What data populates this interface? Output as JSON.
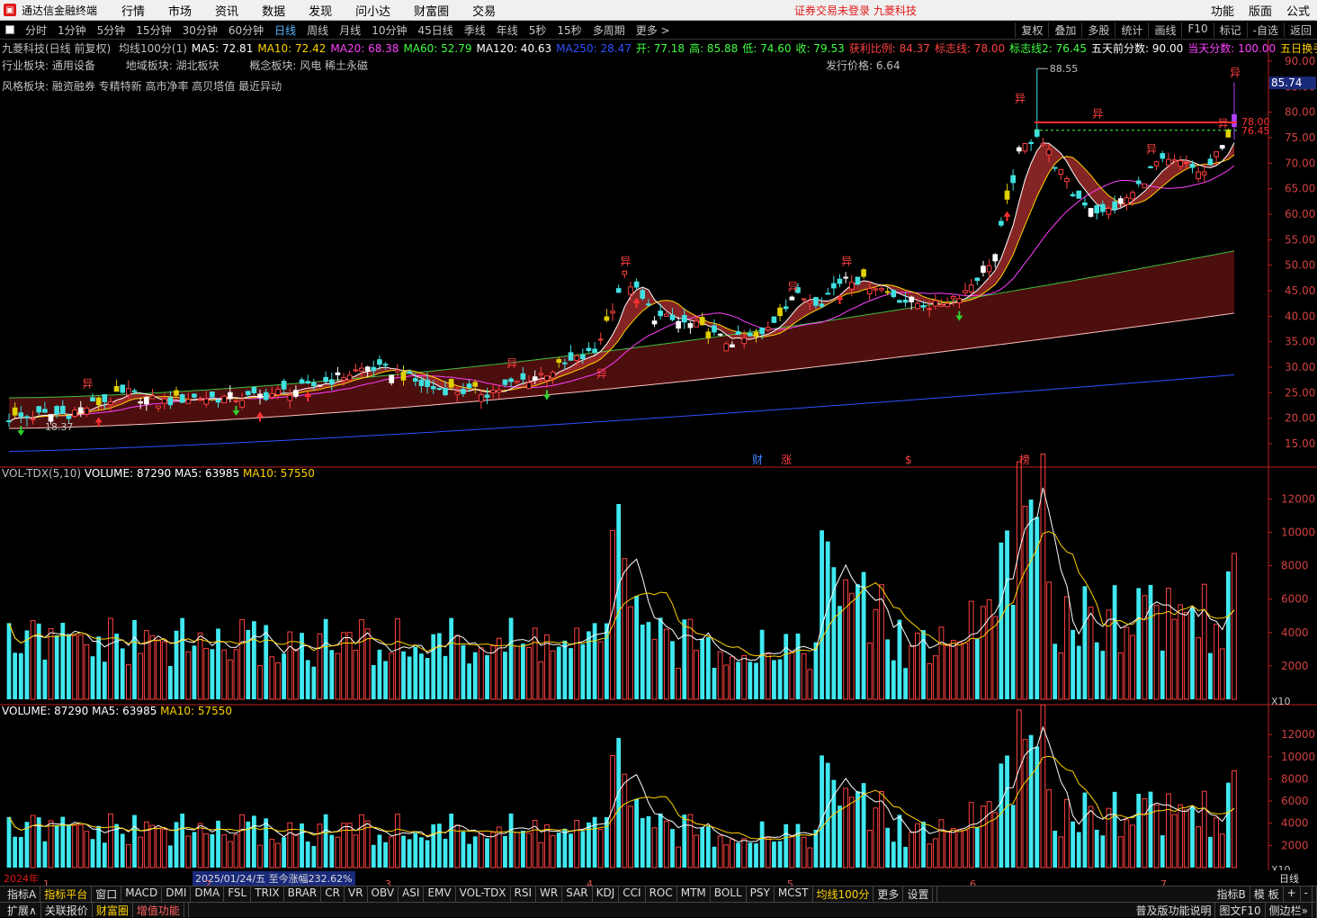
{
  "app": {
    "title": "通达信金融终端",
    "menu": [
      "行情",
      "市场",
      "资讯",
      "数据",
      "发现",
      "问小达",
      "财富圈",
      "交易"
    ],
    "notice": "证券交易未登录",
    "stock_name": "九菱科技",
    "right_menu": [
      "功能",
      "版面",
      "公式"
    ]
  },
  "periods": [
    "分时",
    "1分钟",
    "5分钟",
    "15分钟",
    "30分钟",
    "60分钟",
    "日线",
    "周线",
    "月线",
    "10分钟",
    "45日线",
    "季线",
    "年线",
    "5秒",
    "15秒",
    "多周期",
    "更多 >"
  ],
  "active_period": "日线",
  "toolbar_right": [
    "复权",
    "叠加",
    "多股",
    "统计",
    "画线",
    "F10",
    "标记",
    "-自选",
    "返回"
  ],
  "header": {
    "title": "九菱科技(日线 前复权)",
    "items": [
      {
        "t": "均线100分(1)",
        "c": "#c0c0c0"
      },
      {
        "t": "MA5: 72.81",
        "c": "#ffffff"
      },
      {
        "t": "MA10: 72.42",
        "c": "#ffd200"
      },
      {
        "t": "MA20: 68.38",
        "c": "#ff40ff"
      },
      {
        "t": "MA60: 52.79",
        "c": "#40ff40"
      },
      {
        "t": "MA120: 40.63",
        "c": "#ffffff"
      },
      {
        "t": "MA250: 28.47",
        "c": "#3050ff"
      },
      {
        "t": "开: 77.18",
        "c": "#40ff40"
      },
      {
        "t": "高: 85.88",
        "c": "#40ff40"
      },
      {
        "t": "低: 74.60",
        "c": "#40ff40"
      },
      {
        "t": "收: 79.53",
        "c": "#40ff40"
      },
      {
        "t": "获利比例: 84.37",
        "c": "#ff4040"
      },
      {
        "t": "标志线: 78.00",
        "c": "#ff4040"
      },
      {
        "t": "标志线2: 76.45",
        "c": "#40ff40"
      },
      {
        "t": "五天前分数: 90.00",
        "c": "#ffffff"
      },
      {
        "t": "当天分数: 100.00",
        "c": "#ff40ff"
      },
      {
        "t": "五日换手:◇",
        "c": "#ffd200"
      }
    ]
  },
  "sectors": {
    "industry": "行业板块: 通用设备",
    "region": "地域板块: 湖北板块",
    "concept": "概念板块: 风电 稀土永磁",
    "issue_price": "发行价格: 6.64",
    "style": "风格板块: 融资融券 专精特新 高市净率 高贝塔值 最近异动"
  },
  "price_panel": {
    "y_ticks": [
      "90.00",
      "85.00",
      "80.00",
      "75.00",
      "70.00",
      "65.00",
      "60.00",
      "55.00",
      "50.00",
      "45.00",
      "40.00",
      "35.00",
      "30.00",
      "25.00",
      "20.00",
      "15.00"
    ],
    "current_price": "85.74",
    "high_label": "88.55",
    "low_label": "18.37",
    "flag_line": "78.00",
    "flag_line2": "76.45",
    "abnormal_tag": "异",
    "event_tags": [
      "财",
      "涨",
      "$",
      "榜"
    ]
  },
  "vol_panel1": {
    "title": "VOL-TDX(5,10)",
    "volume": "VOLUME: 87290",
    "ma5": "MA5: 63985",
    "ma10": "MA10: 57550",
    "y_ticks": [
      "12000",
      "10000",
      "8000",
      "6000",
      "4000",
      "2000"
    ],
    "unit": "X10"
  },
  "vol_panel2": {
    "volume": "VOLUME: 87290",
    "ma5": "MA5: 63985",
    "ma10": "MA10: 57550",
    "y_ticks": [
      "12000",
      "10000",
      "8000",
      "6000",
      "4000",
      "2000"
    ],
    "unit": "X10"
  },
  "status": {
    "year": "2024年",
    "months": [
      "1",
      "2",
      "3",
      "4",
      "5",
      "6",
      "7"
    ],
    "date_info": "2025/01/24/五 至今涨幅232.62%",
    "right_label": "日线"
  },
  "tabs": [
    "指标A",
    "指标平台",
    "窗口",
    "MACD",
    "DMI",
    "DMA",
    "FSL",
    "TRIX",
    "BRAR",
    "CR",
    "VR",
    "OBV",
    "ASI",
    "EMV",
    "VOL-TDX",
    "RSI",
    "WR",
    "SAR",
    "KDJ",
    "CCI",
    "ROC",
    "MTM",
    "BOLL",
    "PSY",
    "MCST",
    "均线100分",
    "更多",
    "设置"
  ],
  "active_tab": "均线100分",
  "tabs_right": [
    "指标B",
    "模 板",
    "+",
    "-"
  ],
  "bottom": [
    "扩展∧",
    "关联报价",
    "财富圈",
    "增值功能"
  ],
  "bottom_right": [
    "普及版功能说明",
    "图文F10",
    "侧边栏»"
  ],
  "colors": {
    "up": "#ff4040",
    "down": "#40e0e0",
    "purple": "#b040ff",
    "yellow": "#e0d000"
  }
}
